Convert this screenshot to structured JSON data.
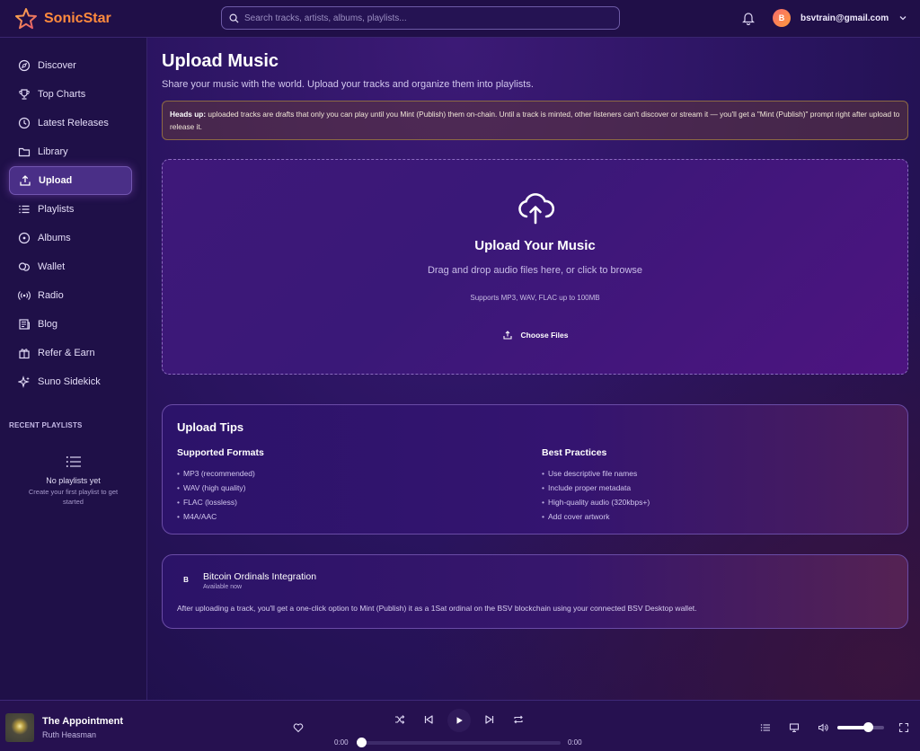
{
  "app": {
    "name": "SonicStar",
    "accent": "#ff8a3d"
  },
  "header": {
    "search_placeholder": "Search tracks, artists, albums, playlists...",
    "user_initial": "B",
    "user_email": "bsvtrain@gmail.com",
    "icons": [
      "search-icon",
      "bell-icon",
      "chevron-down-icon"
    ]
  },
  "sidebar": {
    "items": [
      {
        "label": "Discover",
        "icon": "compass-icon"
      },
      {
        "label": "Top Charts",
        "icon": "trophy-icon"
      },
      {
        "label": "Latest Releases",
        "icon": "clock-icon"
      },
      {
        "label": "Library",
        "icon": "folder-icon"
      },
      {
        "label": "Upload",
        "icon": "upload-icon",
        "active": true
      },
      {
        "label": "Playlists",
        "icon": "list-icon"
      },
      {
        "label": "Albums",
        "icon": "disc-icon"
      },
      {
        "label": "Wallet",
        "icon": "wallet-icon"
      },
      {
        "label": "Radio",
        "icon": "radio-icon"
      },
      {
        "label": "Blog",
        "icon": "newspaper-icon"
      },
      {
        "label": "Refer & Earn",
        "icon": "gift-icon"
      },
      {
        "label": "Suno Sidekick",
        "icon": "sparkles-icon"
      }
    ],
    "recent_title": "RECENT PLAYLISTS",
    "empty_title": "No playlists yet",
    "empty_sub": "Create your first playlist to get started"
  },
  "main": {
    "title": "Upload Music",
    "subtitle": "Share your music with the world. Upload your tracks and organize them into playlists.",
    "notice_strong": "Heads up:",
    "notice_text": "uploaded tracks are drafts that only you can play until you Mint (Publish) them on-chain. Until a track is minted, other listeners can't discover or stream it — you'll get a \"Mint (Publish)\" prompt right after upload to release it.",
    "dropzone": {
      "title": "Upload Your Music",
      "subtitle": "Drag and drop audio files here, or click to browse",
      "supports": "Supports MP3, WAV, FLAC up to 100MB",
      "button": "Choose Files"
    },
    "tips": {
      "title": "Upload Tips",
      "formats_title": "Supported Formats",
      "formats": [
        "MP3 (recommended)",
        "WAV (high quality)",
        "FLAC (lossless)",
        "M4A/AAC"
      ],
      "practices_title": "Best Practices",
      "practices": [
        "Use descriptive file names",
        "Include proper metadata",
        "High-quality audio (320kbps+)",
        "Add cover artwork"
      ]
    },
    "ordinals": {
      "badge": "B",
      "title": "Bitcoin Ordinals Integration",
      "status": "Available now",
      "description": "After uploading a track, you'll get a one-click option to Mint (Publish) it as a 1Sat ordinal on the BSV blockchain using your connected BSV Desktop wallet."
    }
  },
  "player": {
    "track_title": "The Appointment",
    "artist": "Ruth Heasman",
    "time_current": "0:00",
    "time_total": "0:00",
    "progress": 0,
    "volume": 0.65
  }
}
